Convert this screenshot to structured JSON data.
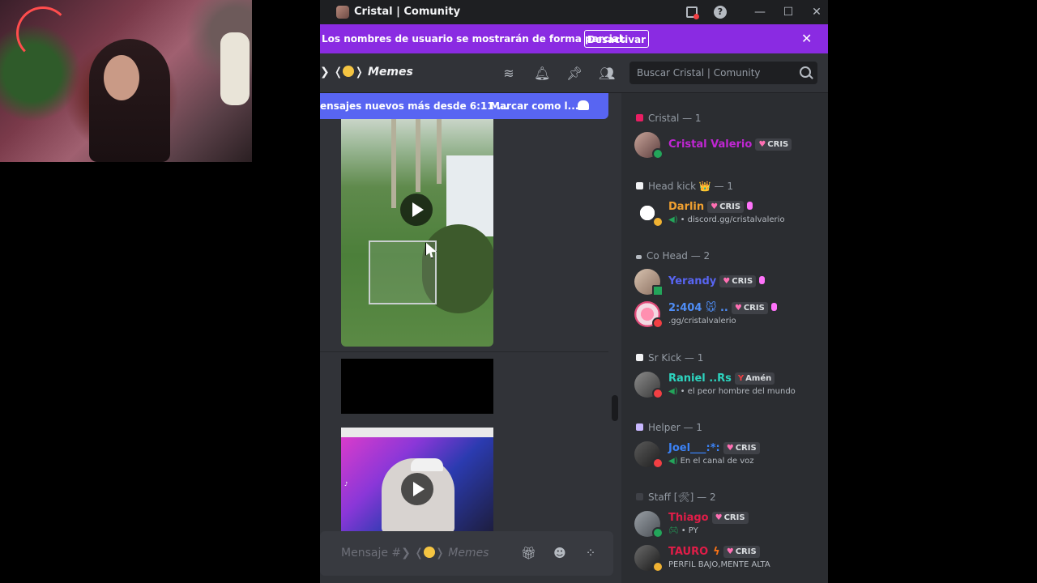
{
  "window": {
    "title": "Cristal | Comunity",
    "help_label": "?",
    "minimize": "—",
    "maximize": "☐",
    "close": "✕"
  },
  "banner": {
    "text": "Los nombres de usuario se mostrarán de forma parcial.",
    "button": "Desactivar",
    "close": "✕"
  },
  "channel": {
    "prefix": "❯ ❬",
    "suffix": "❭",
    "name": "Memes"
  },
  "search": {
    "placeholder": "Buscar Cristal | Comunity"
  },
  "new_messages": {
    "text": "ensajes nuevos más desde 6:11 ...",
    "mark_read": "Marcar como l..."
  },
  "composer": {
    "prefix": "Mensaje #❯ ❬",
    "suffix": "❭",
    "channel": "Memes"
  },
  "members": {
    "groups": [
      {
        "role": "Cristal — 1",
        "role_color": "#e91e63",
        "members": [
          {
            "name": "Cristal Valerio",
            "name_color": "#c026d3",
            "tag": "CRIS",
            "status": "#23a55a"
          }
        ]
      },
      {
        "role": "Head kick 👑 — 1",
        "role_color": "#f2f3f5",
        "members": [
          {
            "name": "Darlin",
            "name_color": "#f0a030",
            "tag": "CRIS",
            "sub": "• discord.gg/cristalvalerio",
            "status": "#f0b232"
          }
        ]
      },
      {
        "role": "Co Head — 2",
        "role_color": "#b5bac1",
        "members": [
          {
            "name": "Yerandy",
            "name_color": "#5865f2",
            "tag": "CRIS",
            "status": "#23a55a"
          },
          {
            "name": "2:404 🐭 ..",
            "name_color": "#4f8ef7",
            "tag": "CRIS",
            "sub": ".gg/cristalvalerio",
            "status": "#f23f43"
          }
        ]
      },
      {
        "role": "Sr Kick — 1",
        "role_color": "#f2f3f5",
        "members": [
          {
            "name": "Raniel ..Rs",
            "name_color": "#2dd4bf",
            "tag": "Amén",
            "tag_icon": "Y",
            "sub": "• el peor hombre del mundo",
            "status": "#f23f43"
          }
        ]
      },
      {
        "role": "Helper — 1",
        "role_color": "#c9b8ff",
        "members": [
          {
            "name": "Joel___:*:",
            "name_color": "#3b82f6",
            "tag": "CRIS",
            "sub": "En el canal de voz",
            "status": "#f23f43"
          }
        ]
      },
      {
        "role": "Staff [🛠] — 2",
        "role_color": "#3f4147",
        "members": [
          {
            "name": "Thiago",
            "name_color": "#e11d48",
            "tag": "CRIS",
            "sub": "• PY",
            "status": "#23a55a"
          },
          {
            "name": "TAURO",
            "name_color": "#e11d48",
            "tag": "CRIS",
            "sub": "PERFIL BAJO,MENTE ALTA",
            "status": "#f0b232"
          }
        ]
      }
    ]
  },
  "colors": {
    "accent_banner": "#8a2be2",
    "blurple": "#5865f2",
    "online": "#23a55a",
    "dnd": "#f23f43",
    "idle": "#f0b232"
  }
}
